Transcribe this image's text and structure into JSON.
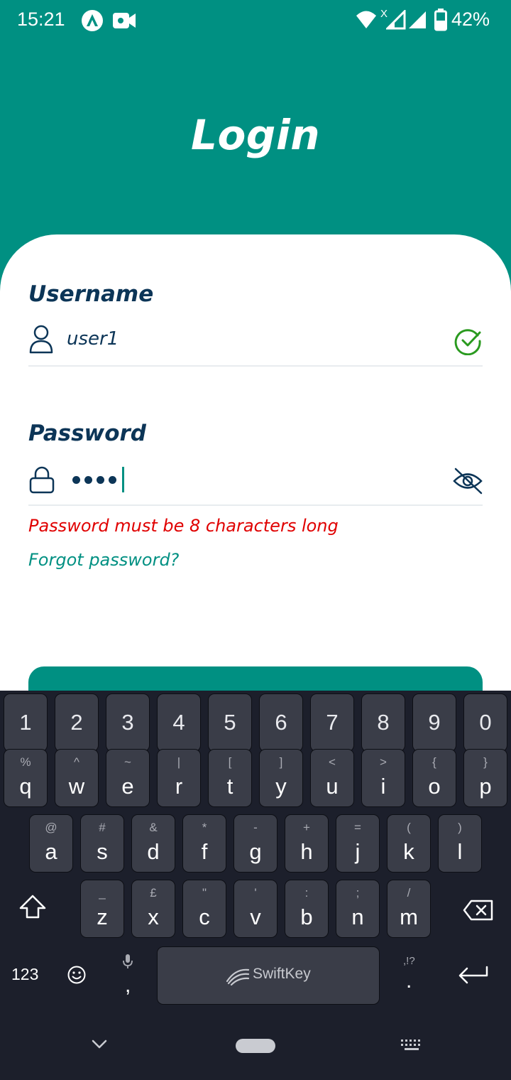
{
  "status_bar": {
    "time": "15:21",
    "battery_percent": "42%",
    "icons": [
      "app-icon",
      "video-record-icon",
      "wifi-icon",
      "signal-icon",
      "signal-icon",
      "battery-icon"
    ]
  },
  "header": {
    "title": "Login"
  },
  "form": {
    "username": {
      "label": "Username",
      "value": "user1",
      "valid": true
    },
    "password": {
      "label": "Password",
      "masked_length": 4,
      "error": "Password must be 8 characters long",
      "visibility": "hidden"
    },
    "forgot_label": "Forgot password?"
  },
  "colors": {
    "primary": "#009082",
    "label": "#0c3557",
    "error": "#e00000",
    "success": "#2a9a1f",
    "keyboard_bg": "#1c1f2b"
  },
  "keyboard": {
    "numbers": [
      "1",
      "2",
      "3",
      "4",
      "5",
      "6",
      "7",
      "8",
      "9",
      "0"
    ],
    "row1": [
      {
        "key": "q",
        "hint": "%"
      },
      {
        "key": "w",
        "hint": "^"
      },
      {
        "key": "e",
        "hint": "~"
      },
      {
        "key": "r",
        "hint": "|"
      },
      {
        "key": "t",
        "hint": "["
      },
      {
        "key": "y",
        "hint": "]"
      },
      {
        "key": "u",
        "hint": "<"
      },
      {
        "key": "i",
        "hint": ">"
      },
      {
        "key": "o",
        "hint": "{"
      },
      {
        "key": "p",
        "hint": "}"
      }
    ],
    "row2": [
      {
        "key": "a",
        "hint": "@"
      },
      {
        "key": "s",
        "hint": "#"
      },
      {
        "key": "d",
        "hint": "&"
      },
      {
        "key": "f",
        "hint": "*"
      },
      {
        "key": "g",
        "hint": "-"
      },
      {
        "key": "h",
        "hint": "+"
      },
      {
        "key": "j",
        "hint": "="
      },
      {
        "key": "k",
        "hint": "("
      },
      {
        "key": "l",
        "hint": ")"
      }
    ],
    "row3": [
      {
        "key": "z",
        "hint": "_"
      },
      {
        "key": "x",
        "hint": "£"
      },
      {
        "key": "c",
        "hint": "\""
      },
      {
        "key": "v",
        "hint": "'"
      },
      {
        "key": "b",
        "hint": ":"
      },
      {
        "key": "n",
        "hint": ";"
      },
      {
        "key": "m",
        "hint": "/"
      }
    ],
    "symbols_label": "123",
    "comma": ",",
    "period": ".",
    "period_hint": ",!?",
    "space_label": "SwiftKey"
  }
}
